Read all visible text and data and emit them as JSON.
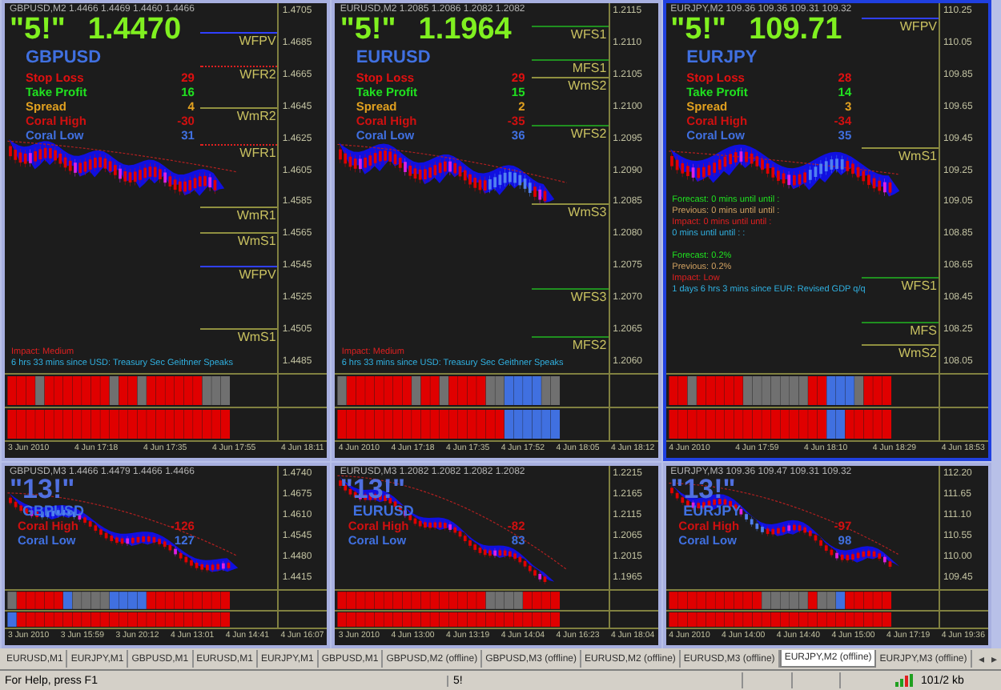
{
  "charts": [
    {
      "header": "GBPUSD,M2  1.4466 1.4469 1.4460 1.4466",
      "signal": "\"5!\"",
      "price": "1.4470",
      "symbol": "GBPUSD",
      "active": false,
      "stats": [
        {
          "kind": "stop",
          "label": "Stop Loss",
          "value": "29"
        },
        {
          "kind": "take",
          "label": "Take Profit",
          "value": "16"
        },
        {
          "kind": "spread",
          "label": "Spread",
          "value": "4"
        },
        {
          "kind": "high",
          "label": "Coral High",
          "value": "-30"
        },
        {
          "kind": "low",
          "label": "Coral Low",
          "value": "31"
        }
      ],
      "levels": [
        {
          "label": "WFPV",
          "color": "#3040ff",
          "kind": "solid"
        },
        {
          "label": "WFR2",
          "color": "#e02020",
          "kind": "dotted"
        },
        {
          "label": "WmR2",
          "color": "#909040",
          "kind": "solid"
        },
        {
          "label": "WFR1",
          "color": "#e02020",
          "kind": "dotted"
        },
        {
          "label": "WmR1",
          "color": "#909040",
          "kind": "solid"
        },
        {
          "label": "WmS1",
          "color": "#909040",
          "kind": "solid"
        },
        {
          "label": "WFPV",
          "color": "#3040ff",
          "kind": "solid"
        },
        {
          "label": "WmS1",
          "color": "#909040",
          "kind": "solid"
        }
      ],
      "news": [
        [
          {
            "kind": "impact",
            "text": "Impact: Medium"
          },
          {
            "kind": "info",
            "text": "6 hrs 33 mins since USD: Treasury Sec Geithner Speaks"
          }
        ]
      ],
      "axis": [
        "1.4705",
        "1.4685",
        "1.4665",
        "1.4645",
        "1.4625",
        "1.4605",
        "1.4585",
        "1.4565",
        "1.4545",
        "1.4525",
        "1.4505",
        "1.4485"
      ],
      "time_axis": [
        "3 Jun 2010",
        "4 Jun 17:18",
        "4 Jun 17:35",
        "4 Jun 17:55",
        "4 Jun 18:11"
      ]
    },
    {
      "header": "EURUSD,M2  1.2085 1.2086 1.2082 1.2082",
      "signal": "\"5!\"",
      "price": "1.1964",
      "symbol": "EURUSD",
      "active": false,
      "stats": [
        {
          "kind": "stop",
          "label": "Stop Loss",
          "value": "29"
        },
        {
          "kind": "take",
          "label": "Take Profit",
          "value": "15"
        },
        {
          "kind": "spread",
          "label": "Spread",
          "value": "2"
        },
        {
          "kind": "high",
          "label": "Coral High",
          "value": "-35"
        },
        {
          "kind": "low",
          "label": "Coral Low",
          "value": "36"
        }
      ],
      "levels": [
        {
          "label": "WFS1",
          "color": "#209020",
          "kind": "solid"
        },
        {
          "label": "MFS1",
          "color": "#209020",
          "kind": "solid"
        },
        {
          "label": "WmS2",
          "color": "#909040",
          "kind": "solid"
        },
        {
          "label": "WFS2",
          "color": "#209020",
          "kind": "solid"
        },
        {
          "label": "WmS3",
          "color": "#909040",
          "kind": "solid"
        },
        {
          "label": "WFS3",
          "color": "#209020",
          "kind": "solid"
        },
        {
          "label": "MFS2",
          "color": "#209020",
          "kind": "solid"
        }
      ],
      "news": [
        [
          {
            "kind": "impact",
            "text": "Impact: Medium"
          },
          {
            "kind": "info",
            "text": "6 hrs 33 mins since USD: Treasury Sec Geithner Speaks"
          }
        ]
      ],
      "axis": [
        "1.2115",
        "1.2110",
        "1.2105",
        "1.2100",
        "1.2095",
        "1.2090",
        "1.2085",
        "1.2080",
        "1.2075",
        "1.2070",
        "1.2065",
        "1.2060"
      ],
      "time_axis": [
        "4 Jun 2010",
        "4 Jun 17:18",
        "4 Jun 17:35",
        "4 Jun 17:52",
        "4 Jun 18:05",
        "4 Jun 18:12"
      ]
    },
    {
      "header": "EURJPY,M2  109.36 109.36 109.31 109.32",
      "signal": "\"5!\"",
      "price": "109.71",
      "symbol": "EURJPY",
      "active": true,
      "stats": [
        {
          "kind": "stop",
          "label": "Stop Loss",
          "value": "28"
        },
        {
          "kind": "take",
          "label": "Take Profit",
          "value": "14"
        },
        {
          "kind": "spread",
          "label": "Spread",
          "value": "3"
        },
        {
          "kind": "high",
          "label": "Coral High",
          "value": "-34"
        },
        {
          "kind": "low",
          "label": "Coral Low",
          "value": "35"
        }
      ],
      "levels": [
        {
          "label": "WFPV",
          "color": "#3040ff",
          "kind": "solid"
        },
        {
          "label": "WmS1",
          "color": "#909040",
          "kind": "solid"
        },
        {
          "label": "WFS1",
          "color": "#209020",
          "kind": "solid"
        },
        {
          "label": "MFS",
          "color": "#209020",
          "kind": "solid"
        },
        {
          "label": "WmS2",
          "color": "#909040",
          "kind": "solid"
        }
      ],
      "news": [
        [
          {
            "kind": "forecast",
            "text": "Forecast: 0 mins until until :"
          },
          {
            "kind": "previous",
            "text": "Previous: 0 mins until until :"
          },
          {
            "kind": "impact",
            "text": "Impact: 0 mins until until :"
          },
          {
            "kind": "info",
            "text": "0 mins until until : :"
          }
        ],
        [
          {
            "kind": "forecast",
            "text": "Forecast: 0.2%"
          },
          {
            "kind": "previous",
            "text": "Previous: 0.2%"
          },
          {
            "kind": "impact",
            "text": "Impact: Low"
          },
          {
            "kind": "info",
            "text": "1 days 6 hrs 3 mins since EUR: Revised GDP q/q"
          }
        ]
      ],
      "axis": [
        "110.25",
        "110.05",
        "109.85",
        "109.65",
        "109.45",
        "109.25",
        "109.05",
        "108.85",
        "108.65",
        "108.45",
        "108.25",
        "108.05"
      ],
      "time_axis": [
        "4 Jun 2010",
        "4 Jun 17:59",
        "4 Jun 18:10",
        "4 Jun 18:29",
        "4 Jun 18:53"
      ]
    },
    {
      "header": "GBPUSD,M3  1.4466 1.4479 1.4466 1.4466",
      "signal": "\"13!\"",
      "symbol": "GBPUSD",
      "active": false,
      "stats": [
        {
          "kind": "high",
          "label": "Coral High",
          "value": "-126"
        },
        {
          "kind": "low",
          "label": "Coral Low",
          "value": "127"
        }
      ],
      "axis": [
        "1.4740",
        "1.4675",
        "1.4610",
        "1.4545",
        "1.4480",
        "1.4415"
      ],
      "time_axis": [
        "3 Jun 2010",
        "3 Jun 15:59",
        "3 Jun 20:12",
        "4 Jun 13:01",
        "4 Jun 14:41",
        "4 Jun 16:07"
      ]
    },
    {
      "header": "EURUSD,M3  1.2082 1.2082 1.2082 1.2082",
      "signal": "\"13!\"",
      "symbol": "EURUSD",
      "active": false,
      "stats": [
        {
          "kind": "high",
          "label": "Coral High",
          "value": "-82"
        },
        {
          "kind": "low",
          "label": "Coral Low",
          "value": "83"
        }
      ],
      "axis": [
        "1.2215",
        "1.2165",
        "1.2115",
        "1.2065",
        "1.2015",
        "1.1965"
      ],
      "time_axis": [
        "3 Jun 2010",
        "4 Jun 13:00",
        "4 Jun 13:19",
        "4 Jun 14:04",
        "4 Jun 16:23",
        "4 Jun 18:04"
      ]
    },
    {
      "header": "EURJPY,M3  109.36 109.47 109.31 109.32",
      "signal": "\"13!\"",
      "symbol": "EURJPY",
      "active": false,
      "stats": [
        {
          "kind": "high",
          "label": "Coral High",
          "value": "-97"
        },
        {
          "kind": "low",
          "label": "Coral Low",
          "value": "98"
        }
      ],
      "axis": [
        "112.20",
        "111.65",
        "111.10",
        "110.55",
        "110.00",
        "109.45"
      ],
      "time_axis": [
        "4 Jun 2010",
        "4 Jun 14:00",
        "4 Jun 14:40",
        "4 Jun 15:00",
        "4 Jun 17:19",
        "4 Jun 19:36"
      ]
    }
  ],
  "tabs": [
    {
      "label": "EURUSD,M1",
      "selected": false
    },
    {
      "label": "EURJPY,M1",
      "selected": false
    },
    {
      "label": "GBPUSD,M1",
      "selected": false
    },
    {
      "label": "EURUSD,M1",
      "selected": false
    },
    {
      "label": "EURJPY,M1",
      "selected": false
    },
    {
      "label": "GBPUSD,M1",
      "selected": false
    },
    {
      "label": "GBPUSD,M2 (offline)",
      "selected": false
    },
    {
      "label": "GBPUSD,M3 (offline)",
      "selected": false
    },
    {
      "label": "EURUSD,M2 (offline)",
      "selected": false
    },
    {
      "label": "EURUSD,M3 (offline)",
      "selected": false
    },
    {
      "label": "EURJPY,M2 (offline)",
      "selected": true
    },
    {
      "label": "EURJPY,M3 (offline)",
      "selected": false
    }
  ],
  "tab_arrows": [
    "◂",
    "▸"
  ],
  "status_bar": {
    "help": "For Help, press F1",
    "profile": "5!",
    "traffic": "101/2 kb"
  }
}
